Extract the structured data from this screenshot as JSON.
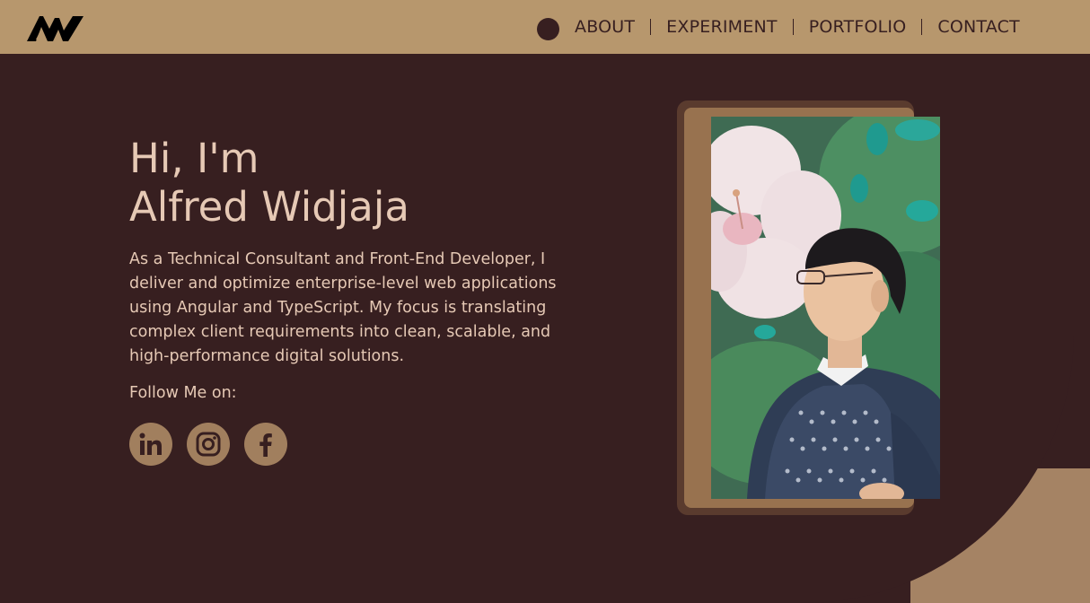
{
  "nav": {
    "logo_text": "AW",
    "links": [
      "ABOUT",
      "EXPERIMENT",
      "PORTFOLIO",
      "CONTACT"
    ]
  },
  "hero": {
    "greeting": "Hi, I'm",
    "name": "Alfred Widjaja",
    "description": "As a Technical Consultant and Front-End Developer, I deliver and optimize enterprise-level web applications using Angular and TypeScript. My focus is translating complex client requirements into clean, scalable, and high-performance digital solutions.",
    "follow_label": "Follow Me on:",
    "socials": [
      "linkedin-icon",
      "instagram-icon",
      "facebook-icon"
    ]
  },
  "colors": {
    "navbar": "#b7976d",
    "background": "#371f20",
    "text": "#e6c9b5",
    "accent": "#a17f5e"
  }
}
